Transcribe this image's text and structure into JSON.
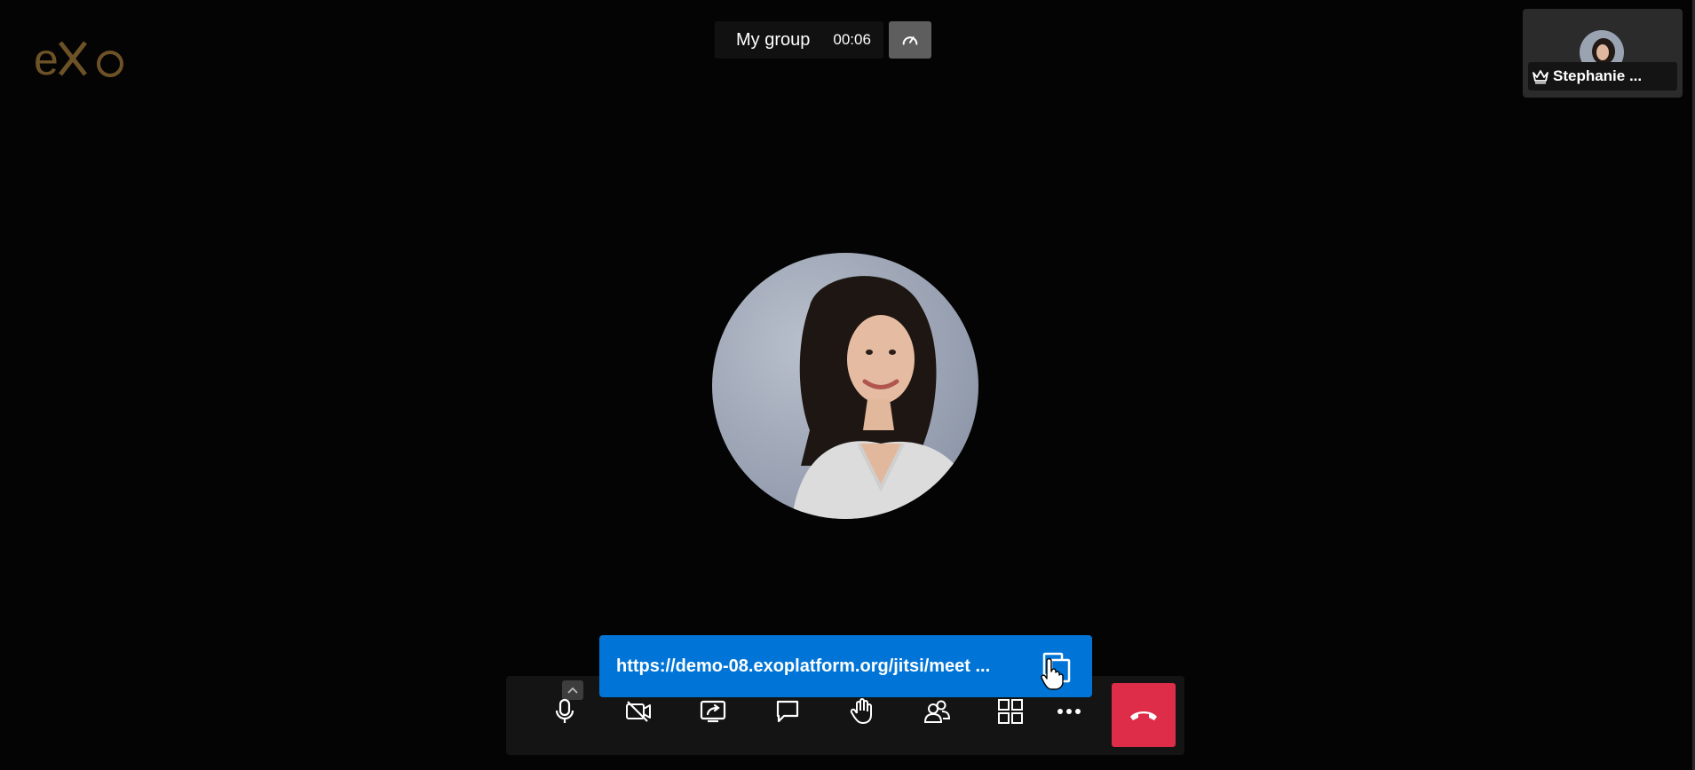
{
  "brand": {
    "logo_text": "eXo",
    "logo_color": "#7a5a2a"
  },
  "header": {
    "meeting_title": "My group",
    "duration": "00:06",
    "performance_icon": "speedometer-icon"
  },
  "thumbnail": {
    "participant_name": "Stephanie ...",
    "role_icon": "crown-icon"
  },
  "main": {
    "participant_avatar": "avatar-photo"
  },
  "invite": {
    "url": "https://demo-08.exoplatform.org/jitsi/meet ...",
    "copy_icon": "copy-icon"
  },
  "toolbar": {
    "buttons": [
      {
        "name": "microphone",
        "icon": "microphone-icon"
      },
      {
        "name": "camera",
        "icon": "camera-off-icon"
      },
      {
        "name": "share-screen",
        "icon": "share-screen-icon"
      },
      {
        "name": "chat",
        "icon": "chat-icon"
      },
      {
        "name": "raise-hand",
        "icon": "hand-icon"
      },
      {
        "name": "participants",
        "icon": "participants-icon"
      },
      {
        "name": "tile-view",
        "icon": "grid-icon"
      },
      {
        "name": "more",
        "icon": "more-icon"
      },
      {
        "name": "hangup",
        "icon": "phone-hangup-icon"
      }
    ]
  },
  "colors": {
    "background": "#040404",
    "invite_blue": "#0175d7",
    "hangup_red": "#dd2d48",
    "toolbar_bg": "#141414"
  }
}
